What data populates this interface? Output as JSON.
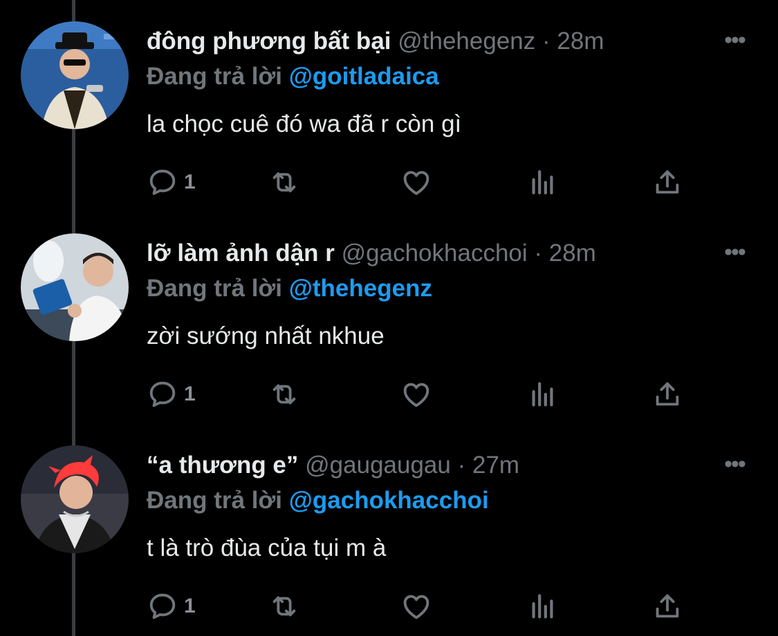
{
  "colors": {
    "background": "#000000",
    "primary_text": "#e7e9ea",
    "secondary_text": "#71767b",
    "accent": "#1d9bf0",
    "thread_line": "#3a3d40"
  },
  "reply_prefix": "Đang trả lời",
  "tweets": [
    {
      "display_name": "đông phương bất bại",
      "handle": "@thehegenz",
      "separator": "·",
      "time": "28m",
      "reply_to": "@goitladaica",
      "text": "la chọc cuê đó wa đã r còn gì",
      "reply_count": "1",
      "more_icon": "more-horizontal-icon"
    },
    {
      "display_name": "lỡ làm ảnh dận r",
      "handle": "@gachokhacchoi",
      "separator": "·",
      "time": "28m",
      "reply_to": "@thehegenz",
      "text": "zời sướng nhất nkhue",
      "reply_count": "1",
      "more_icon": "more-horizontal-icon"
    },
    {
      "display_name": "“a thương e”",
      "handle": "@gaugaugau",
      "separator": "·",
      "time": "27m",
      "reply_to": "@gachokhacchoi",
      "text": "t là trò đùa của tụi m à",
      "reply_count": "1",
      "more_icon": "more-horizontal-icon"
    }
  ],
  "action_icons": [
    "reply-icon",
    "retweet-icon",
    "like-icon",
    "views-icon",
    "share-icon"
  ]
}
